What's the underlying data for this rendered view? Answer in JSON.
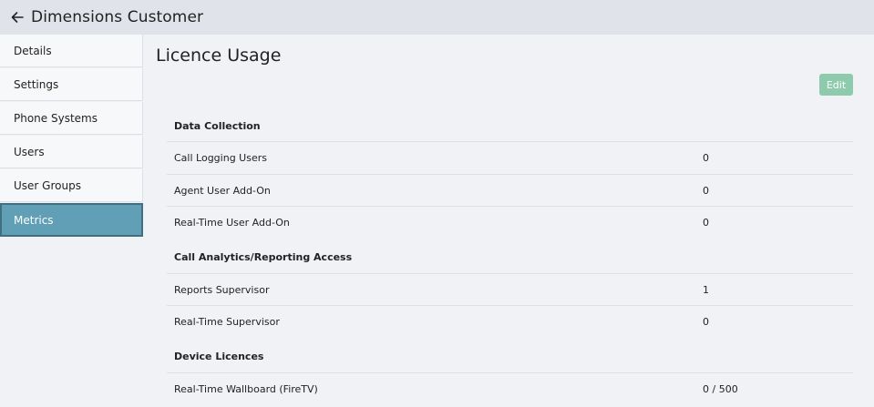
{
  "header": {
    "title": "Dimensions Customer",
    "back_icon": "arrow-left-icon"
  },
  "sidebar": {
    "items": [
      {
        "label": "Details",
        "active": false
      },
      {
        "label": "Settings",
        "active": false
      },
      {
        "label": "Phone Systems",
        "active": false
      },
      {
        "label": "Users",
        "active": false
      },
      {
        "label": "User Groups",
        "active": false
      },
      {
        "label": "Metrics",
        "active": true
      }
    ]
  },
  "main": {
    "title": "Licence Usage",
    "edit_label": "Edit",
    "sections": [
      {
        "heading": "Data Collection",
        "rows": [
          {
            "label": "Call Logging Users",
            "value": "0"
          },
          {
            "label": "Agent User Add-On",
            "value": "0"
          },
          {
            "label": "Real-Time User Add-On",
            "value": "0"
          }
        ]
      },
      {
        "heading": "Call Analytics/Reporting Access",
        "rows": [
          {
            "label": "Reports Supervisor",
            "value": "1"
          },
          {
            "label": "Real-Time Supervisor",
            "value": "0"
          }
        ]
      },
      {
        "heading": "Device Licences",
        "rows": [
          {
            "label": "Real-Time Wallboard (FireTV)",
            "value": "0 / 500"
          }
        ]
      }
    ]
  },
  "colors": {
    "header_bg": "#e0e3ea",
    "page_bg": "#f1f2f6",
    "active_nav": "#609fb5",
    "edit_button": "#8ecbad"
  }
}
